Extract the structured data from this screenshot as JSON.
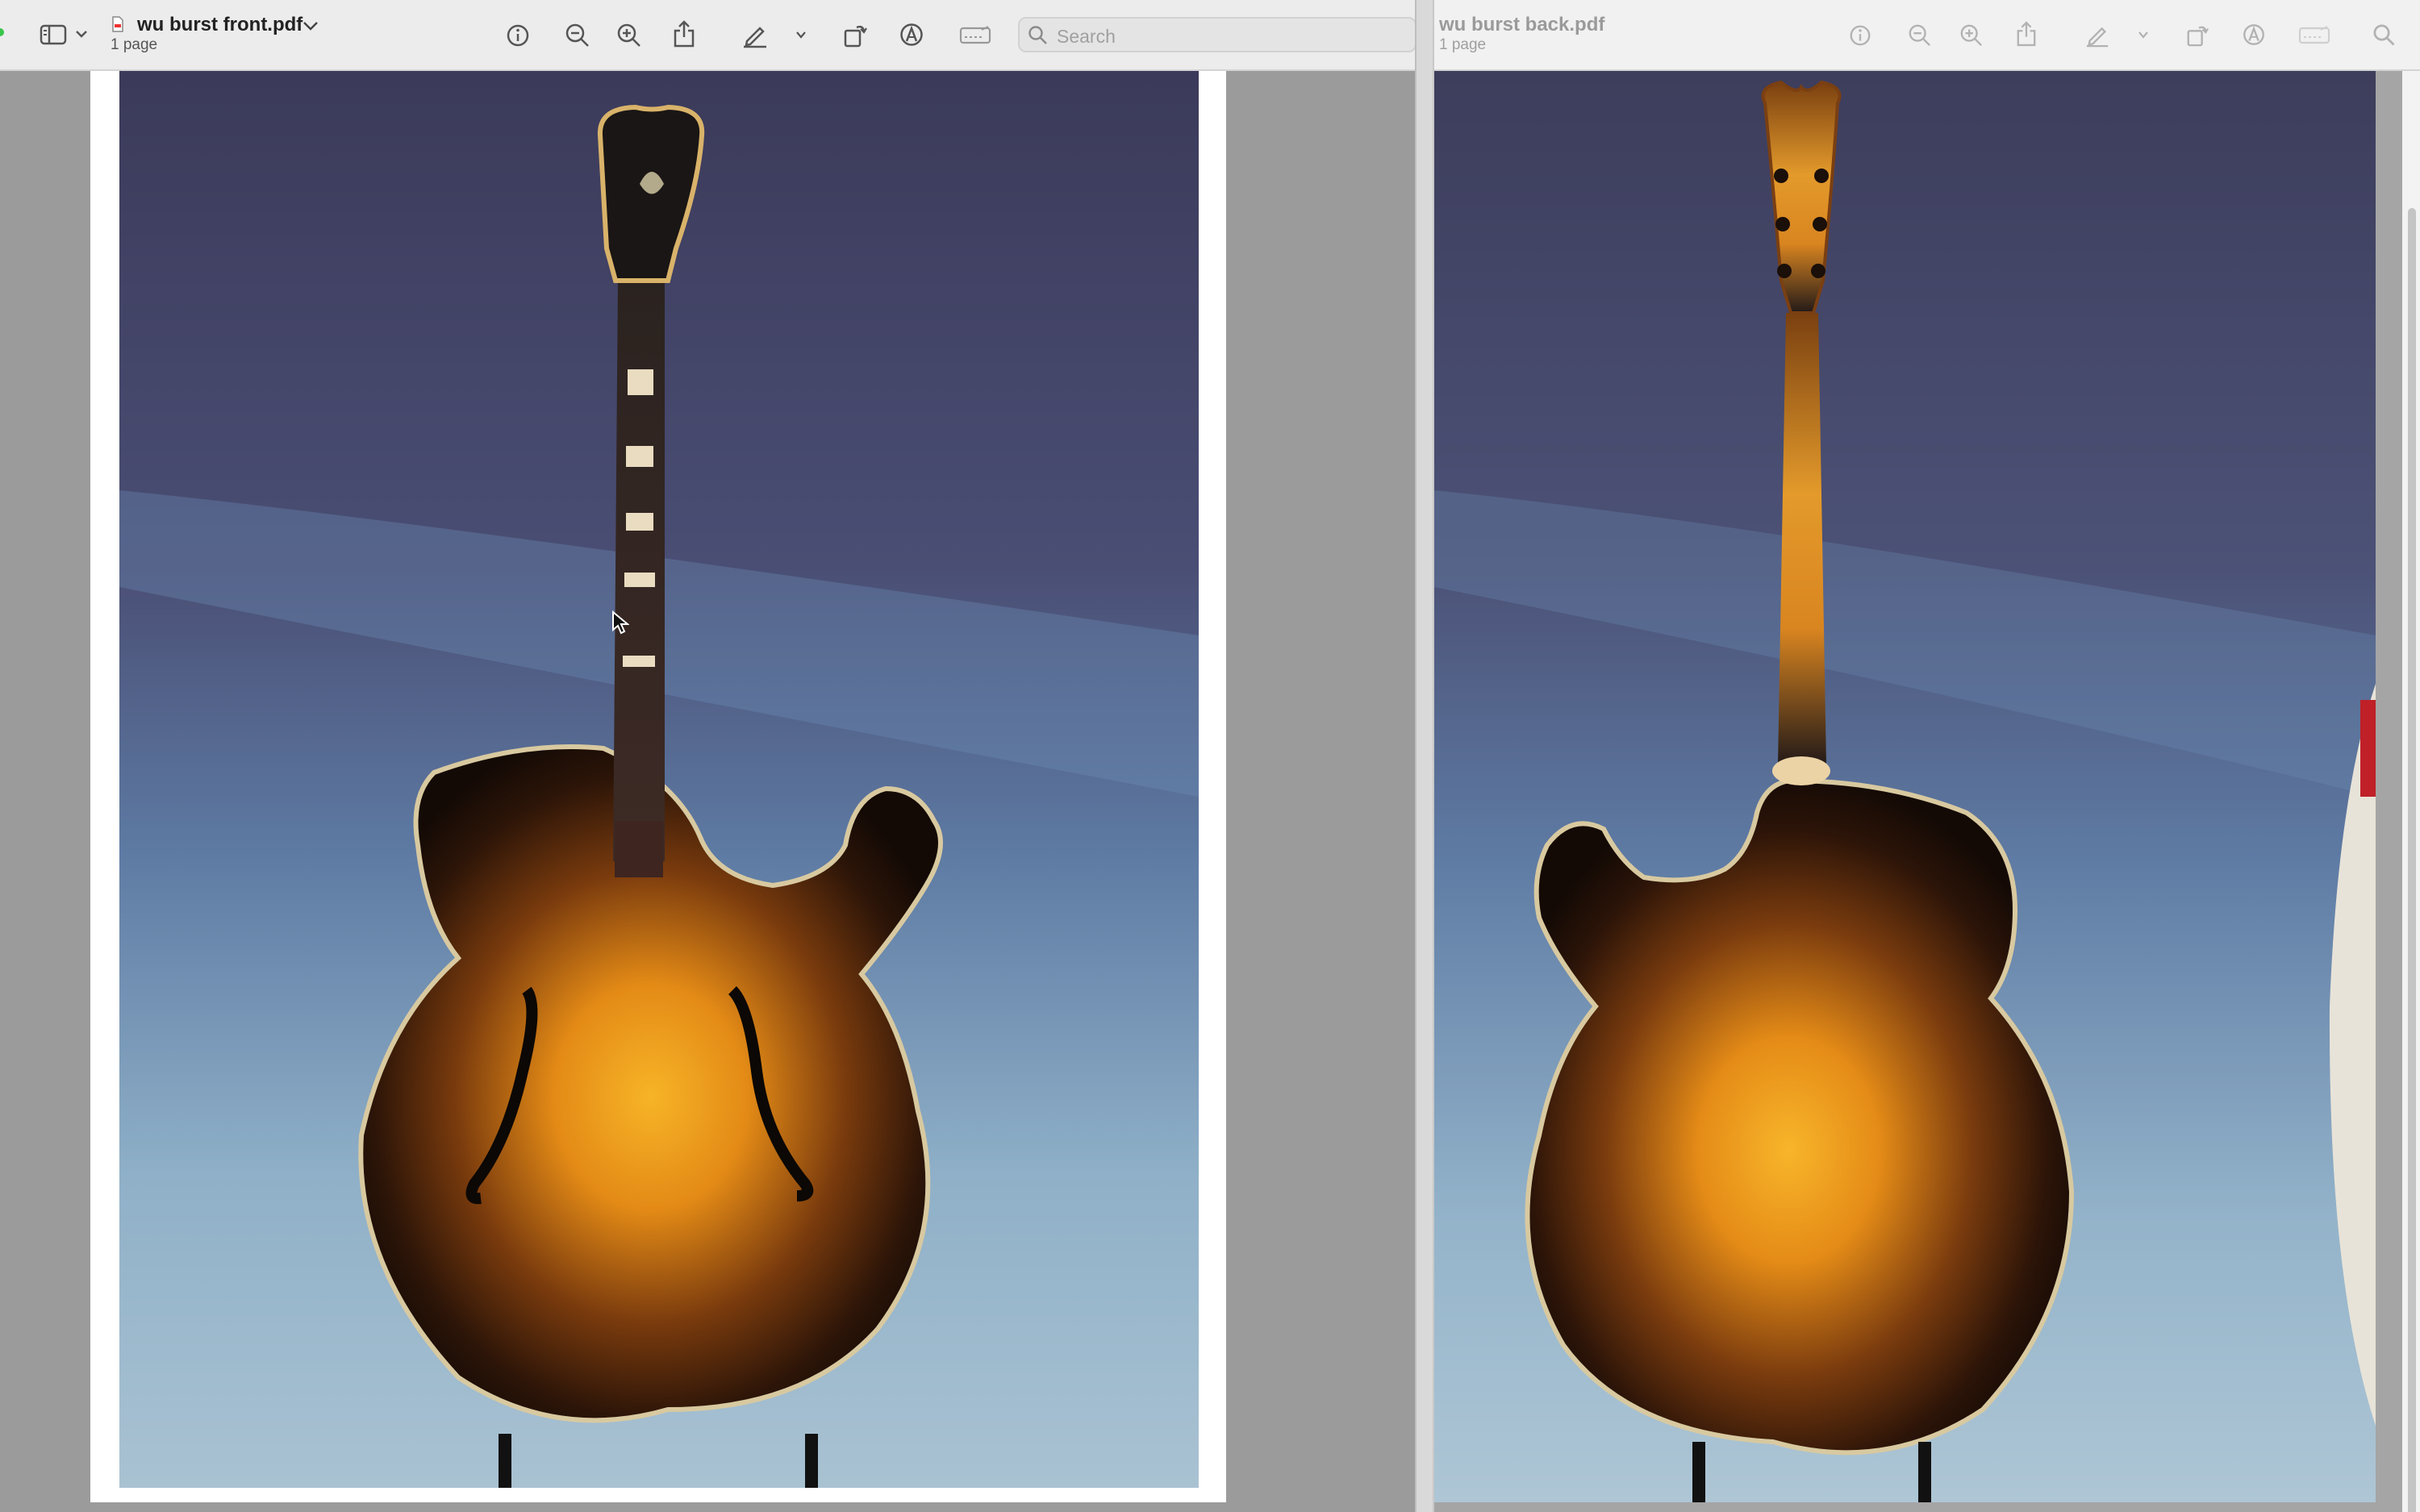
{
  "left_window": {
    "title": "wu burst front.pdf",
    "subtitle": "1 page",
    "search": {
      "placeholder": "Search",
      "value": ""
    },
    "toolbar_icons": [
      "sidebar-icon",
      "chevron-down-icon",
      "info-icon",
      "zoom-out-icon",
      "zoom-in-icon",
      "share-icon",
      "markup-pen-icon",
      "chevron-down-icon",
      "rotate-icon",
      "annotate-icon",
      "form-fill-icon",
      "search-icon"
    ]
  },
  "right_window": {
    "title": "wu burst back.pdf",
    "subtitle": "1 page",
    "toolbar_icons": [
      "info-icon",
      "zoom-out-icon",
      "zoom-in-icon",
      "share-icon",
      "markup-pen-icon",
      "chevron-down-icon",
      "rotate-icon",
      "annotate-icon",
      "form-fill-icon",
      "search-icon"
    ]
  },
  "colors": {
    "toolbar_bg": "#ececec",
    "window_bg": "#9b9b9b",
    "backdrop_top": "#3e3e5e",
    "backdrop_bottom": "#a6c0d3",
    "sunburst_center": "#f7a81a",
    "sunburst_edge": "#1a1208"
  }
}
